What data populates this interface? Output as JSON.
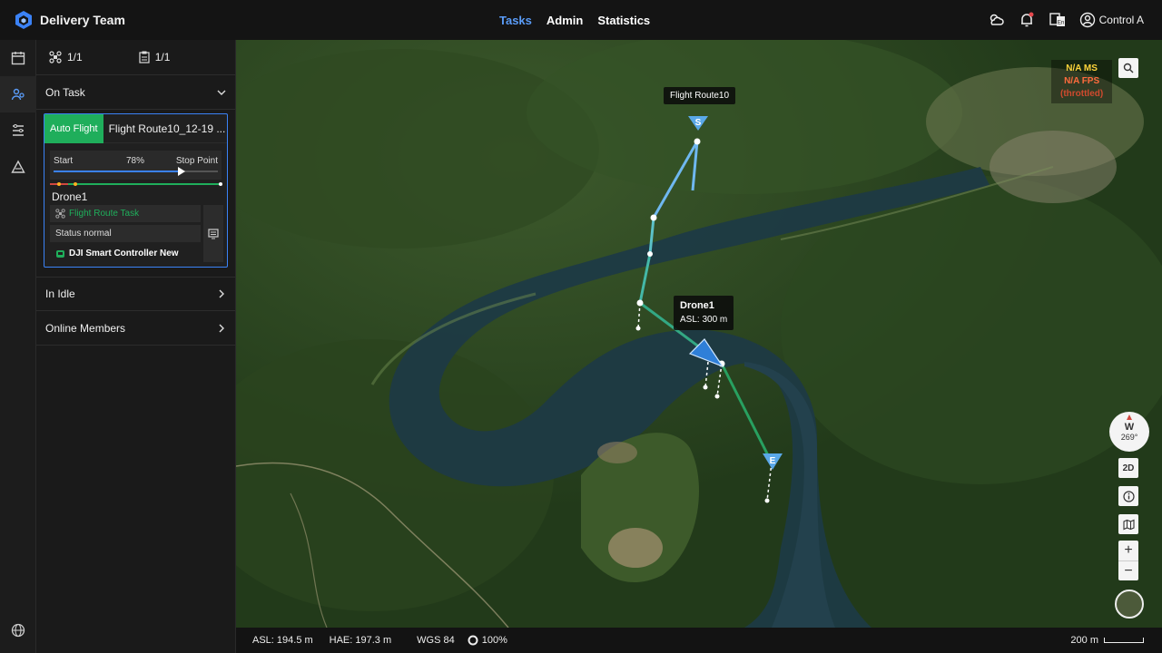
{
  "brand": {
    "name": "Delivery Team",
    "logo_icon": "dji-flighthub-logo"
  },
  "nav": {
    "items": [
      {
        "label": "Tasks",
        "active": true
      },
      {
        "label": "Admin",
        "active": false
      },
      {
        "label": "Statistics",
        "active": false
      }
    ]
  },
  "header_right": {
    "user_label": "Control A"
  },
  "rail": {
    "items": [
      "calendar-icon",
      "team-icon",
      "route-list-icon",
      "map-annotation-icon"
    ],
    "bottom": "globe-icon"
  },
  "panel": {
    "device_count": "1/1",
    "task_count": "1/1",
    "sections": {
      "on_task": "On Task",
      "in_idle": "In Idle",
      "online_members": "Online Members"
    },
    "task": {
      "mode": "Auto Flight",
      "route_name": "Flight Route10_12-19 ...",
      "progress_start": "Start",
      "progress_pct": "78%",
      "progress_value": 0.78,
      "progress_end": "Stop Point",
      "drone_name": "Drone1",
      "task_type": "Flight Route Task",
      "status": "Status normal",
      "controller": "DJI Smart Controller New"
    }
  },
  "map": {
    "route_label": "Flight Route10",
    "drone_label": "Drone1",
    "drone_asl": "ASL: 300 m",
    "start_marker": "S",
    "end_marker": "E",
    "perf": {
      "ms": "N/A MS",
      "fps": "N/A FPS",
      "throttled": "(throttled)"
    },
    "compass_dir": "W",
    "compass_deg": "269°",
    "view_mode": "2D"
  },
  "status": {
    "asl": "ASL: 194.5 m",
    "hae": "HAE: 197.3 m",
    "datum": "WGS 84",
    "signal": "100%",
    "scale": "200 m"
  },
  "colors": {
    "accent": "#5a9cf8",
    "green": "#1fae5b",
    "route_blue": "#6fb8f0"
  }
}
